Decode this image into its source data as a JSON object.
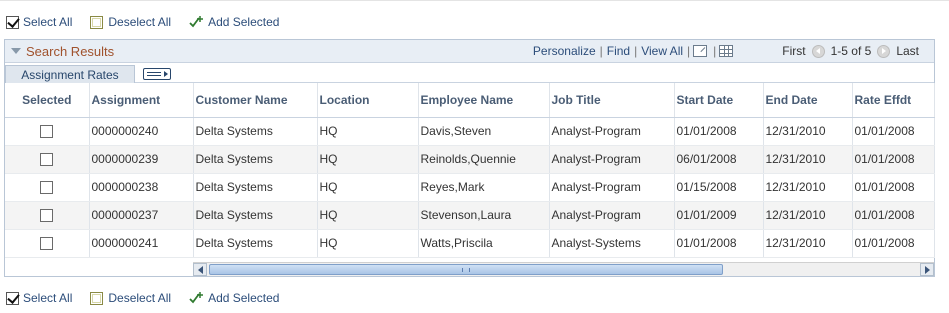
{
  "actions": {
    "select_all": "Select All",
    "deselect_all": "Deselect All",
    "add_selected": "Add Selected"
  },
  "grid": {
    "title": "Search Results",
    "tools": {
      "personalize": "Personalize",
      "find": "Find",
      "view_all": "View All",
      "sep": "|"
    },
    "nav": {
      "first": "First",
      "range": "1-5 of 5",
      "last": "Last"
    },
    "tab": "Assignment Rates",
    "columns": [
      "Selected",
      "Assignment",
      "Customer Name",
      "Location",
      "Employee Name",
      "Job Title",
      "Start Date",
      "End Date",
      "Rate Effdt"
    ],
    "rows": [
      {
        "selected": false,
        "assignment": "0000000240",
        "customer": "Delta Systems",
        "location": "HQ",
        "employee": "Davis,Steven",
        "job_title": "Analyst-Program",
        "start": "01/01/2008",
        "end": "12/31/2010",
        "rate_effdt": "01/01/2008"
      },
      {
        "selected": false,
        "assignment": "0000000239",
        "customer": "Delta Systems",
        "location": "HQ",
        "employee": "Reinolds,Quennie",
        "job_title": "Analyst-Program",
        "start": "06/01/2008",
        "end": "12/31/2010",
        "rate_effdt": "01/01/2008"
      },
      {
        "selected": false,
        "assignment": "0000000238",
        "customer": "Delta Systems",
        "location": "HQ",
        "employee": "Reyes,Mark",
        "job_title": "Analyst-Program",
        "start": "01/15/2008",
        "end": "12/31/2010",
        "rate_effdt": "01/01/2008"
      },
      {
        "selected": false,
        "assignment": "0000000237",
        "customer": "Delta Systems",
        "location": "HQ",
        "employee": "Stevenson,Laura",
        "job_title": "Analyst-Program",
        "start": "01/01/2009",
        "end": "12/31/2010",
        "rate_effdt": "01/01/2008"
      },
      {
        "selected": false,
        "assignment": "0000000241",
        "customer": "Delta Systems",
        "location": "HQ",
        "employee": "Watts,Priscila",
        "job_title": "Analyst-Systems",
        "start": "01/01/2008",
        "end": "12/31/2010",
        "rate_effdt": "01/01/2008"
      }
    ]
  },
  "colors": {
    "link": "#2c4d7a",
    "grid_title": "#a0522d",
    "header_text": "#4a5d75"
  }
}
